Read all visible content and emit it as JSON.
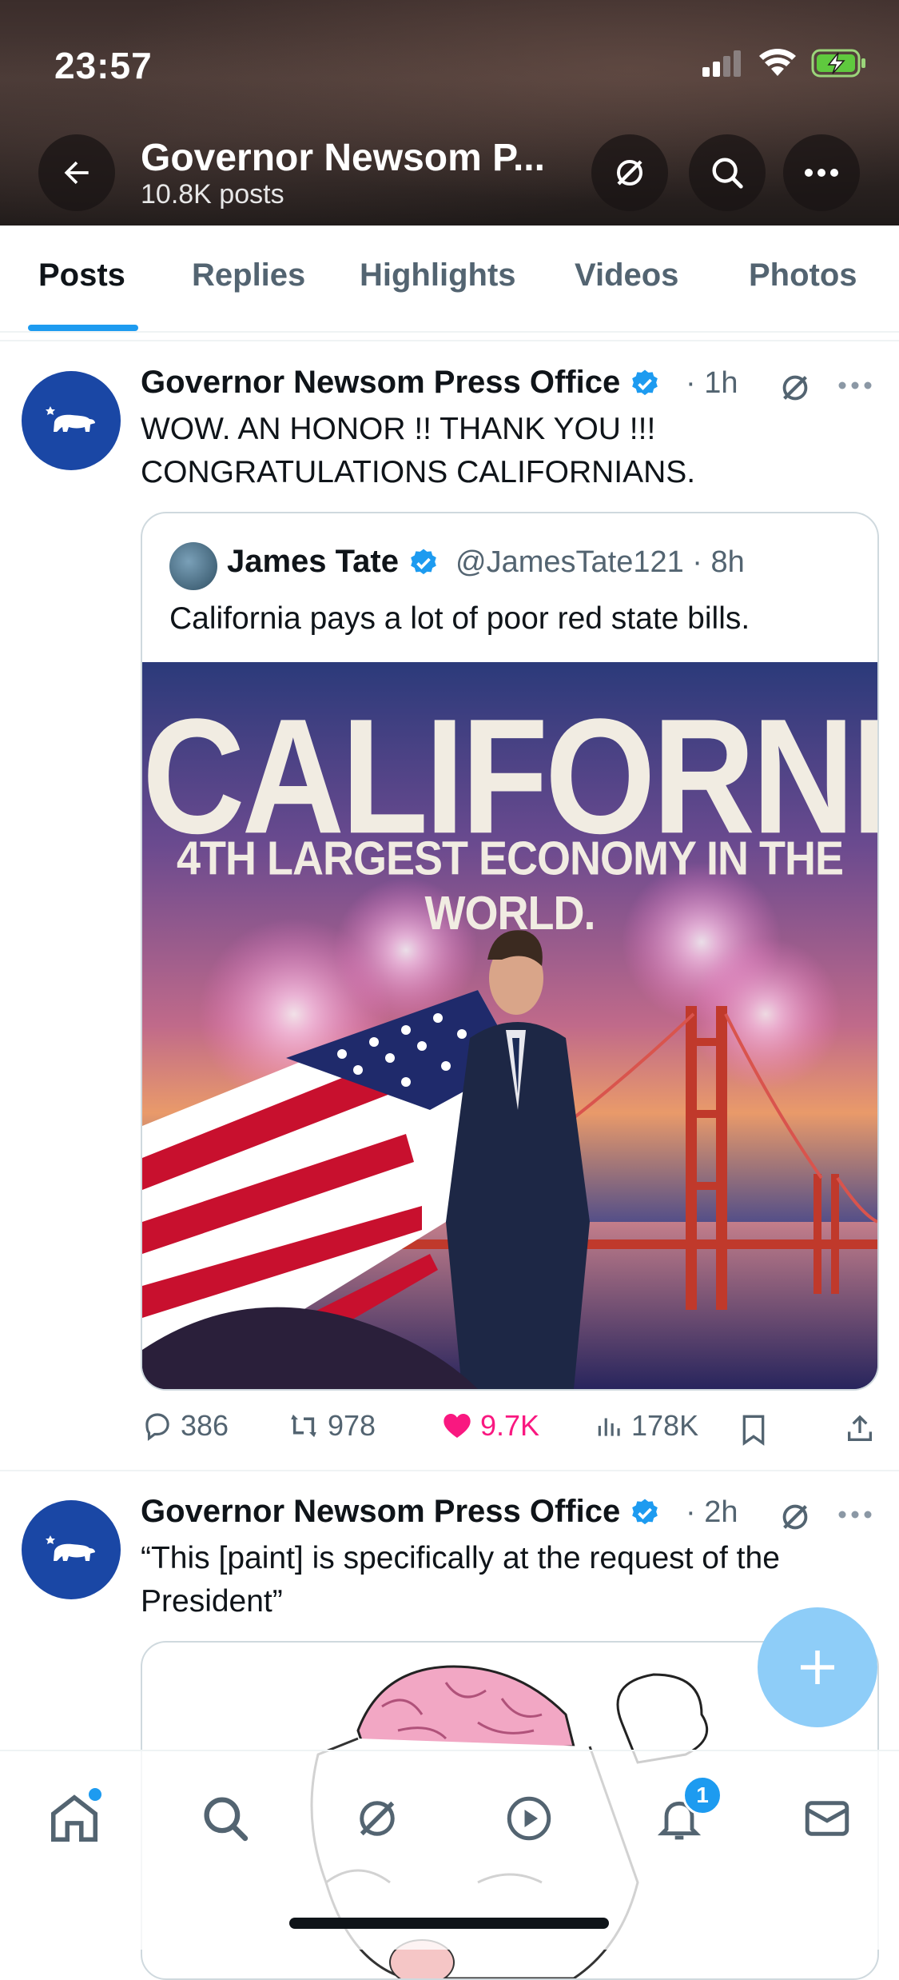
{
  "status_bar": {
    "time": "23:57"
  },
  "header": {
    "title": "Governor Newsom P...",
    "subtitle": "10.8K posts"
  },
  "tabs": [
    {
      "label": "Posts",
      "active": true
    },
    {
      "label": "Replies"
    },
    {
      "label": "Highlights"
    },
    {
      "label": "Videos"
    },
    {
      "label": "Photos"
    }
  ],
  "posts": [
    {
      "author": "Governor Newsom Press Office",
      "time": "· 1h",
      "text_lines": [
        "WOW. AN HONOR !! THANK YOU !!!",
        "CONGRATULATIONS CALIFORNIANS."
      ],
      "quote": {
        "author": "James Tate",
        "handle": "@JamesTate121 · 8h",
        "text": "California pays a lot of poor red state bills.",
        "image_title": "CALIFORNIA",
        "image_subtitle": "4TH LARGEST ECONOMY IN THE WORLD."
      },
      "stats": {
        "replies": "386",
        "reposts": "978",
        "likes": "9.7K",
        "views": "178K"
      }
    },
    {
      "author": "Governor Newsom Press Office",
      "time": "· 2h",
      "text_lines": [
        "“This [paint] is specifically at the request of the",
        "President”"
      ]
    }
  ],
  "notifications_badge": "1",
  "colors": {
    "accent": "#1d9bf0",
    "like": "#f91880",
    "avatar_bg": "#1a47a5"
  }
}
